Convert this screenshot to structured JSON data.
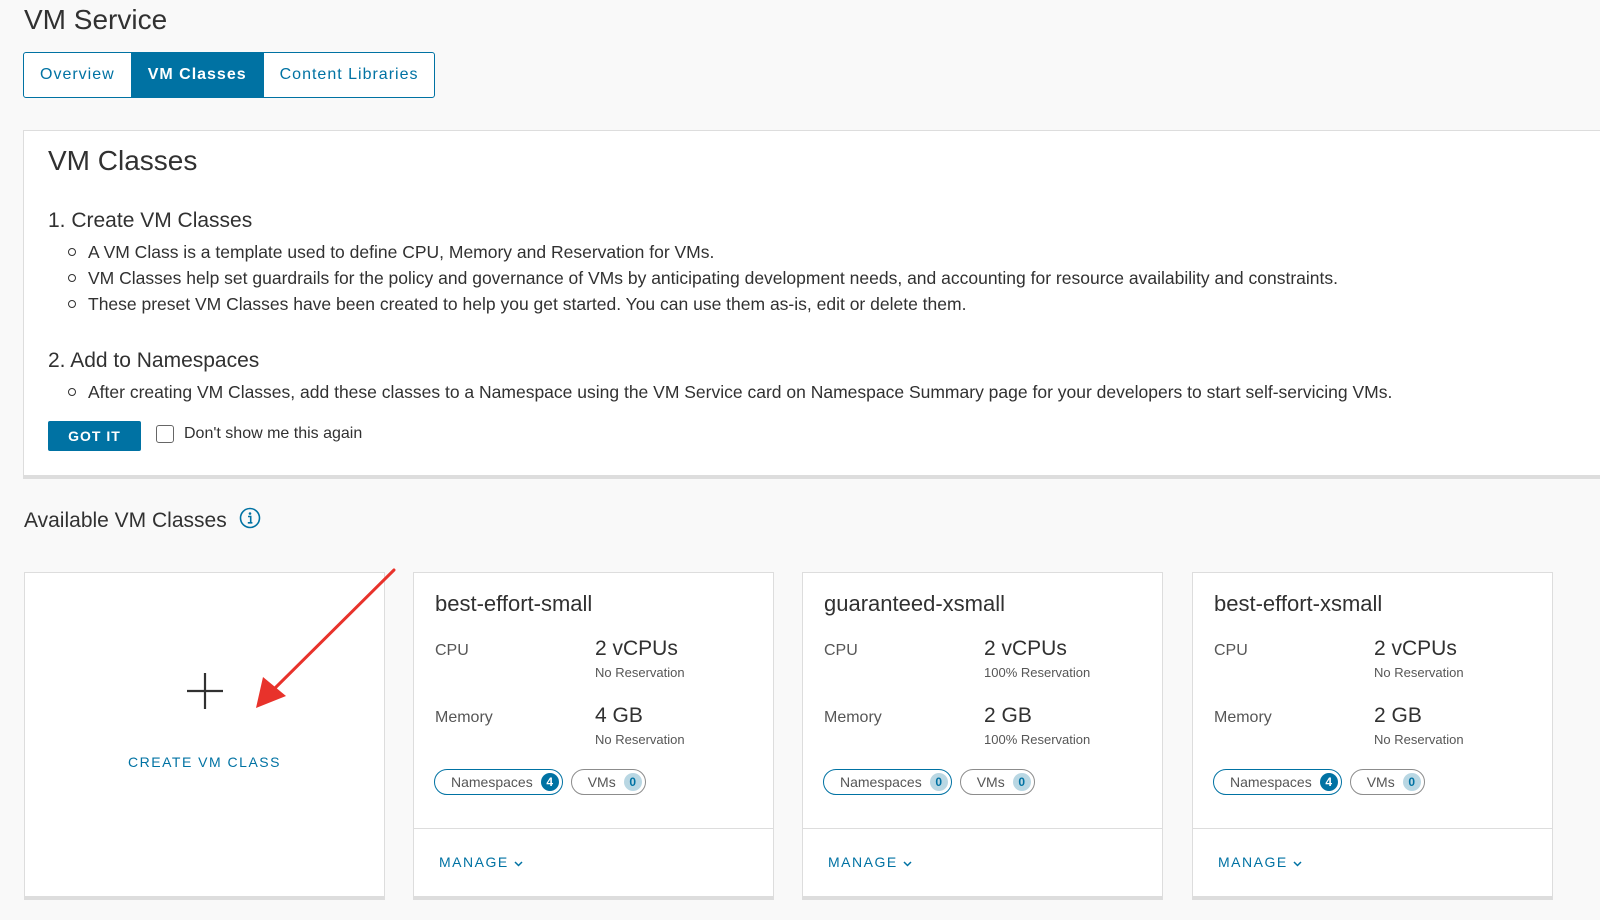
{
  "page": {
    "title": "VM Service"
  },
  "tabs": [
    {
      "label": "Overview",
      "active": false
    },
    {
      "label": "VM Classes",
      "active": true
    },
    {
      "label": "Content Libraries",
      "active": false
    }
  ],
  "info_card": {
    "title": "VM Classes",
    "step1": {
      "heading": "1. Create VM Classes",
      "bullets": [
        "A VM Class is a template used to define CPU, Memory and Reservation for VMs.",
        "VM Classes help set guardrails for the policy and governance of VMs by anticipating development needs, and accounting for resource availability and constraints.",
        "These preset VM Classes have been created to help you get started. You can use them as-is, edit or delete them."
      ]
    },
    "step2": {
      "heading": "2. Add to Namespaces",
      "bullets": [
        "After creating VM Classes, add these classes to a Namespace using the VM Service card on Namespace Summary page for your developers to start self-servicing VMs."
      ]
    },
    "got_it_label": "GOT IT",
    "dont_show_label": "Don't show me this again"
  },
  "available": {
    "heading": "Available VM Classes",
    "icon": "info-icon"
  },
  "create_card": {
    "label": "CREATE VM CLASS",
    "icon": "plus-icon"
  },
  "annotation": {
    "arrow_color": "#e8322b"
  },
  "vm_classes": [
    {
      "name": "best-effort-small",
      "cpu_label": "CPU",
      "cpu_value": "2 vCPUs",
      "cpu_reservation": "No Reservation",
      "memory_label": "Memory",
      "memory_value": "4 GB",
      "memory_reservation": "No Reservation",
      "namespaces_label": "Namespaces",
      "namespaces_count": "4",
      "vms_label": "VMs",
      "vms_count": "0",
      "manage_label": "MANAGE"
    },
    {
      "name": "guaranteed-xsmall",
      "cpu_label": "CPU",
      "cpu_value": "2 vCPUs",
      "cpu_reservation": "100% Reservation",
      "memory_label": "Memory",
      "memory_value": "2 GB",
      "memory_reservation": "100% Reservation",
      "namespaces_label": "Namespaces",
      "namespaces_count": "0",
      "vms_label": "VMs",
      "vms_count": "0",
      "manage_label": "MANAGE"
    },
    {
      "name": "best-effort-xsmall",
      "cpu_label": "CPU",
      "cpu_value": "2 vCPUs",
      "cpu_reservation": "No Reservation",
      "memory_label": "Memory",
      "memory_value": "2 GB",
      "memory_reservation": "No Reservation",
      "namespaces_label": "Namespaces",
      "namespaces_count": "4",
      "vms_label": "VMs",
      "vms_count": "0",
      "manage_label": "MANAGE"
    }
  ],
  "colors": {
    "accent": "#0072a3",
    "badge_zero": "#b9d7e3"
  }
}
